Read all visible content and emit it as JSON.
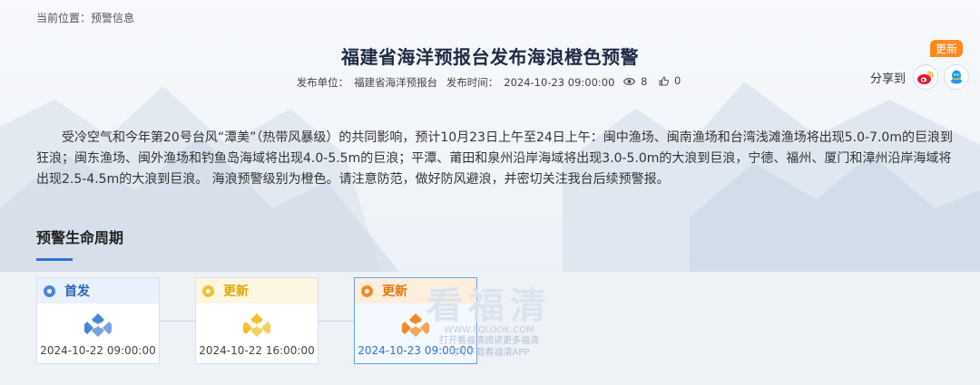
{
  "breadcrumb": {
    "prefix": "当前位置：",
    "current": "预警信息"
  },
  "title": "福建省海洋预报台发布海浪橙色预警",
  "update_badge": "更新",
  "meta": {
    "publisher_label": "发布单位：",
    "publisher": "福建省海洋预报台",
    "time_label": "发布时间：",
    "time": "2024-10-23 09:00:00",
    "views": "8",
    "likes": "0"
  },
  "share": {
    "label": "分享到",
    "icons": [
      "weibo-icon",
      "qq-icon"
    ]
  },
  "body_text": "受冷空气和今年第20号台风“潭美”（热带风暴级）的共同影响，预计10月23日上午至24日上午：闽中渔场、闽南渔场和台湾浅滩渔场将出现5.0-7.0m的巨浪到狂浪；闽东渔场、闽外渔场和钓鱼岛海域将出现4.0-5.5m的巨浪；平潭、莆田和泉州沿岸海域将出现3.0-5.0m的大浪到巨浪，宁德、福州、厦门和漳州沿岸海域将出现2.5-4.5m的大浪到巨浪。 海浪预警级别为橙色。请注意防范，做好防风避浪，并密切关注我台后续预警报。",
  "lifecycle": {
    "title": "预警生命周期",
    "cards": [
      {
        "label": "首发",
        "date": "2024-10-22 09:00:00",
        "dot_color": "#4a86d6",
        "text_color": "#2f63b8",
        "head_bg": "#e8f1fc",
        "logo_color": "#4a86d6"
      },
      {
        "label": "更新",
        "date": "2024-10-22 16:00:00",
        "dot_color": "#f2c12e",
        "text_color": "#e0a800",
        "head_bg": "#fdf6e0",
        "logo_color": "#f2c12e"
      },
      {
        "label": "更新",
        "date": "2024-10-23 09:00:00",
        "dot_color": "#f08a24",
        "text_color": "#e07810",
        "head_bg": "#fdeedd",
        "logo_color": "#f08a24"
      }
    ]
  },
  "watermark": {
    "big": "看福清",
    "url": "WWW.FQLOOK.COM",
    "line1": "打开看福清阅读更多福清",
    "line2": "均可下载看福清APP"
  },
  "colors": {
    "accent": "#2f72d6",
    "badge": "#ff8a1f",
    "weibo": "#e6162d",
    "qq": "#1d9bf0"
  }
}
